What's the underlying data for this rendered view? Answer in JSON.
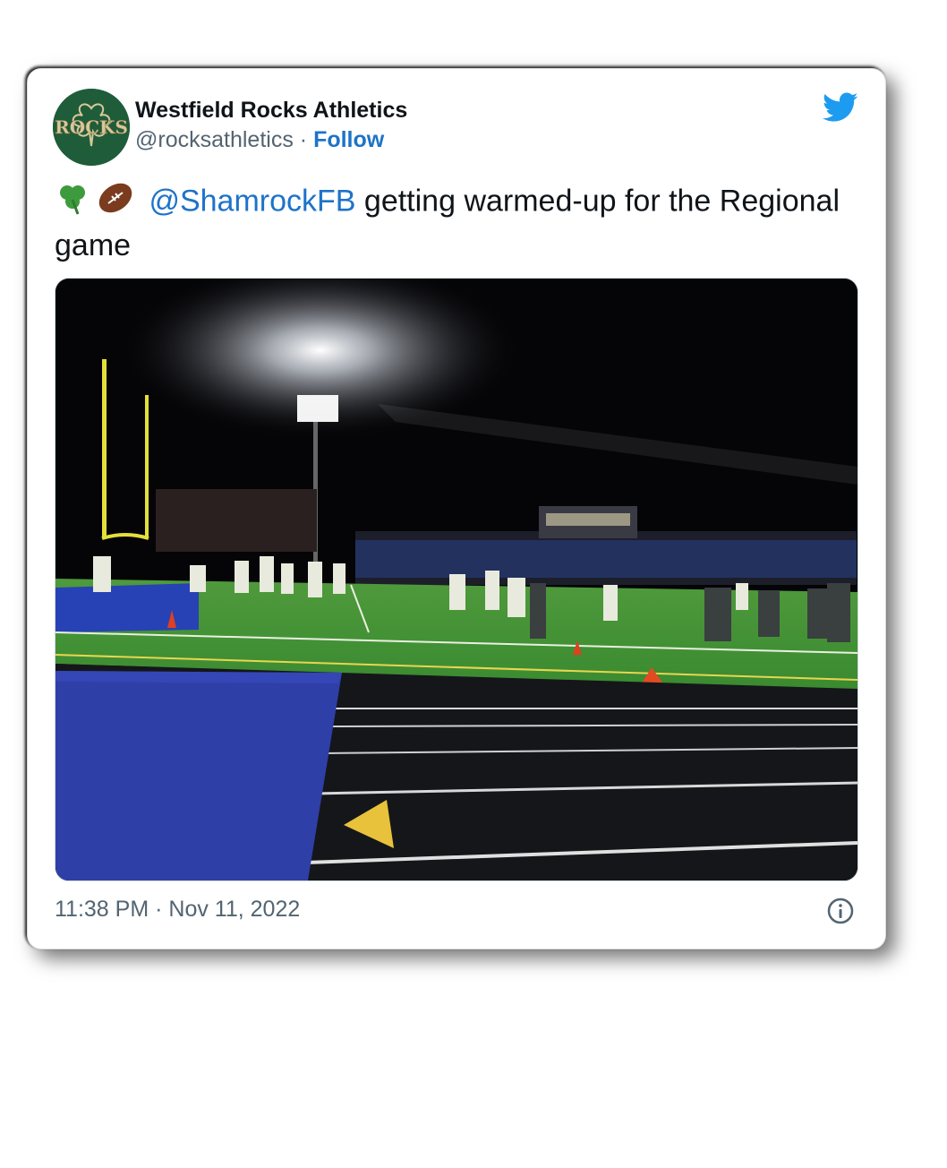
{
  "account": {
    "display_name": "Westfield Rocks Athletics",
    "handle": "@rocksathletics",
    "separator": "·",
    "follow_label": "Follow",
    "avatar_text": "ROCKS"
  },
  "tweet": {
    "emoji_1": "shamrock-icon",
    "emoji_2": "football-icon",
    "mention": "@ShamrockFB",
    "text": " getting warmed-up for the Regional game"
  },
  "footer": {
    "time": "11:38 PM",
    "separator": "·",
    "date": "Nov 11, 2022"
  },
  "icons": {
    "brand": "twitter-bird-icon",
    "info": "info-icon"
  },
  "colors": {
    "link": "#1d73c9",
    "twitter_blue": "#1d9bf0",
    "avatar_green": "#1f5c3a"
  }
}
